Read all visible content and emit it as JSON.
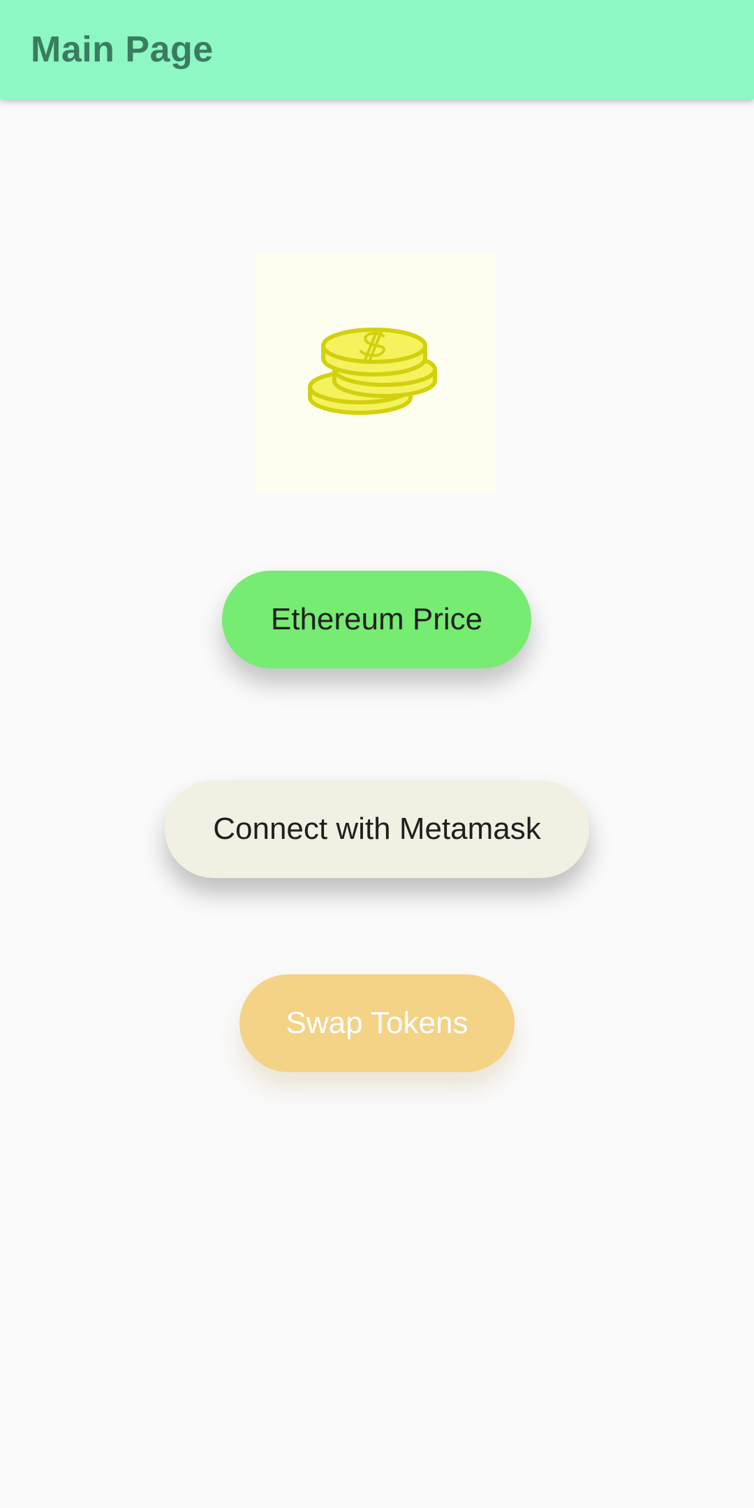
{
  "app_bar": {
    "title": "Main Page",
    "background_color": "#8df8c4",
    "title_color": "#3b7c5e"
  },
  "logo": {
    "icon": "coins-stack-icon",
    "background_color": "#fefef0",
    "icon_fill": "#f4f35e",
    "icon_stroke": "#d3d10e"
  },
  "buttons": {
    "ethereum_price": {
      "label": "Ethereum Price",
      "color": "#76ec72"
    },
    "connect_metamask": {
      "label": "Connect with Metamask",
      "color": "#f2f0e2"
    },
    "swap_tokens": {
      "label": "Swap Tokens",
      "color": "#f4d286"
    }
  },
  "page": {
    "background_color": "#fafafa"
  }
}
